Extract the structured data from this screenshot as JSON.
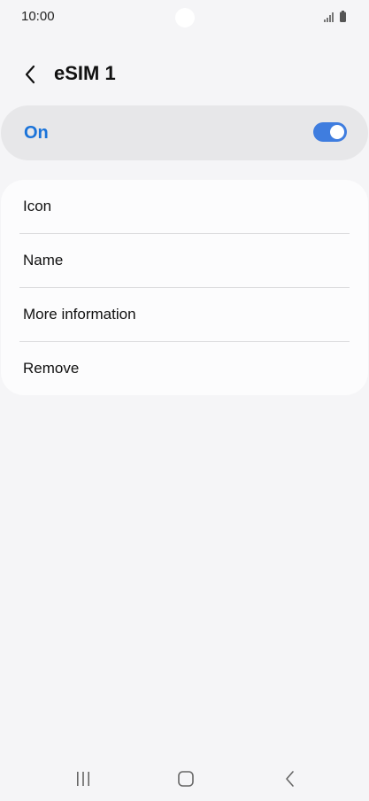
{
  "status_bar": {
    "time": "10:00",
    "icons": [
      "signal-icon",
      "battery-icon"
    ]
  },
  "header": {
    "title": "eSIM 1",
    "back_icon": "chevron-left-icon"
  },
  "master_switch": {
    "label": "On",
    "state": true,
    "accent_color": "#1a73d9",
    "toggle_color": "#3f7ddf"
  },
  "options": [
    {
      "label": "Icon"
    },
    {
      "label": "Name"
    },
    {
      "label": "More information"
    },
    {
      "label": "Remove"
    }
  ],
  "nav_bar": {
    "buttons": [
      "recents-icon",
      "home-icon",
      "back-icon"
    ]
  }
}
